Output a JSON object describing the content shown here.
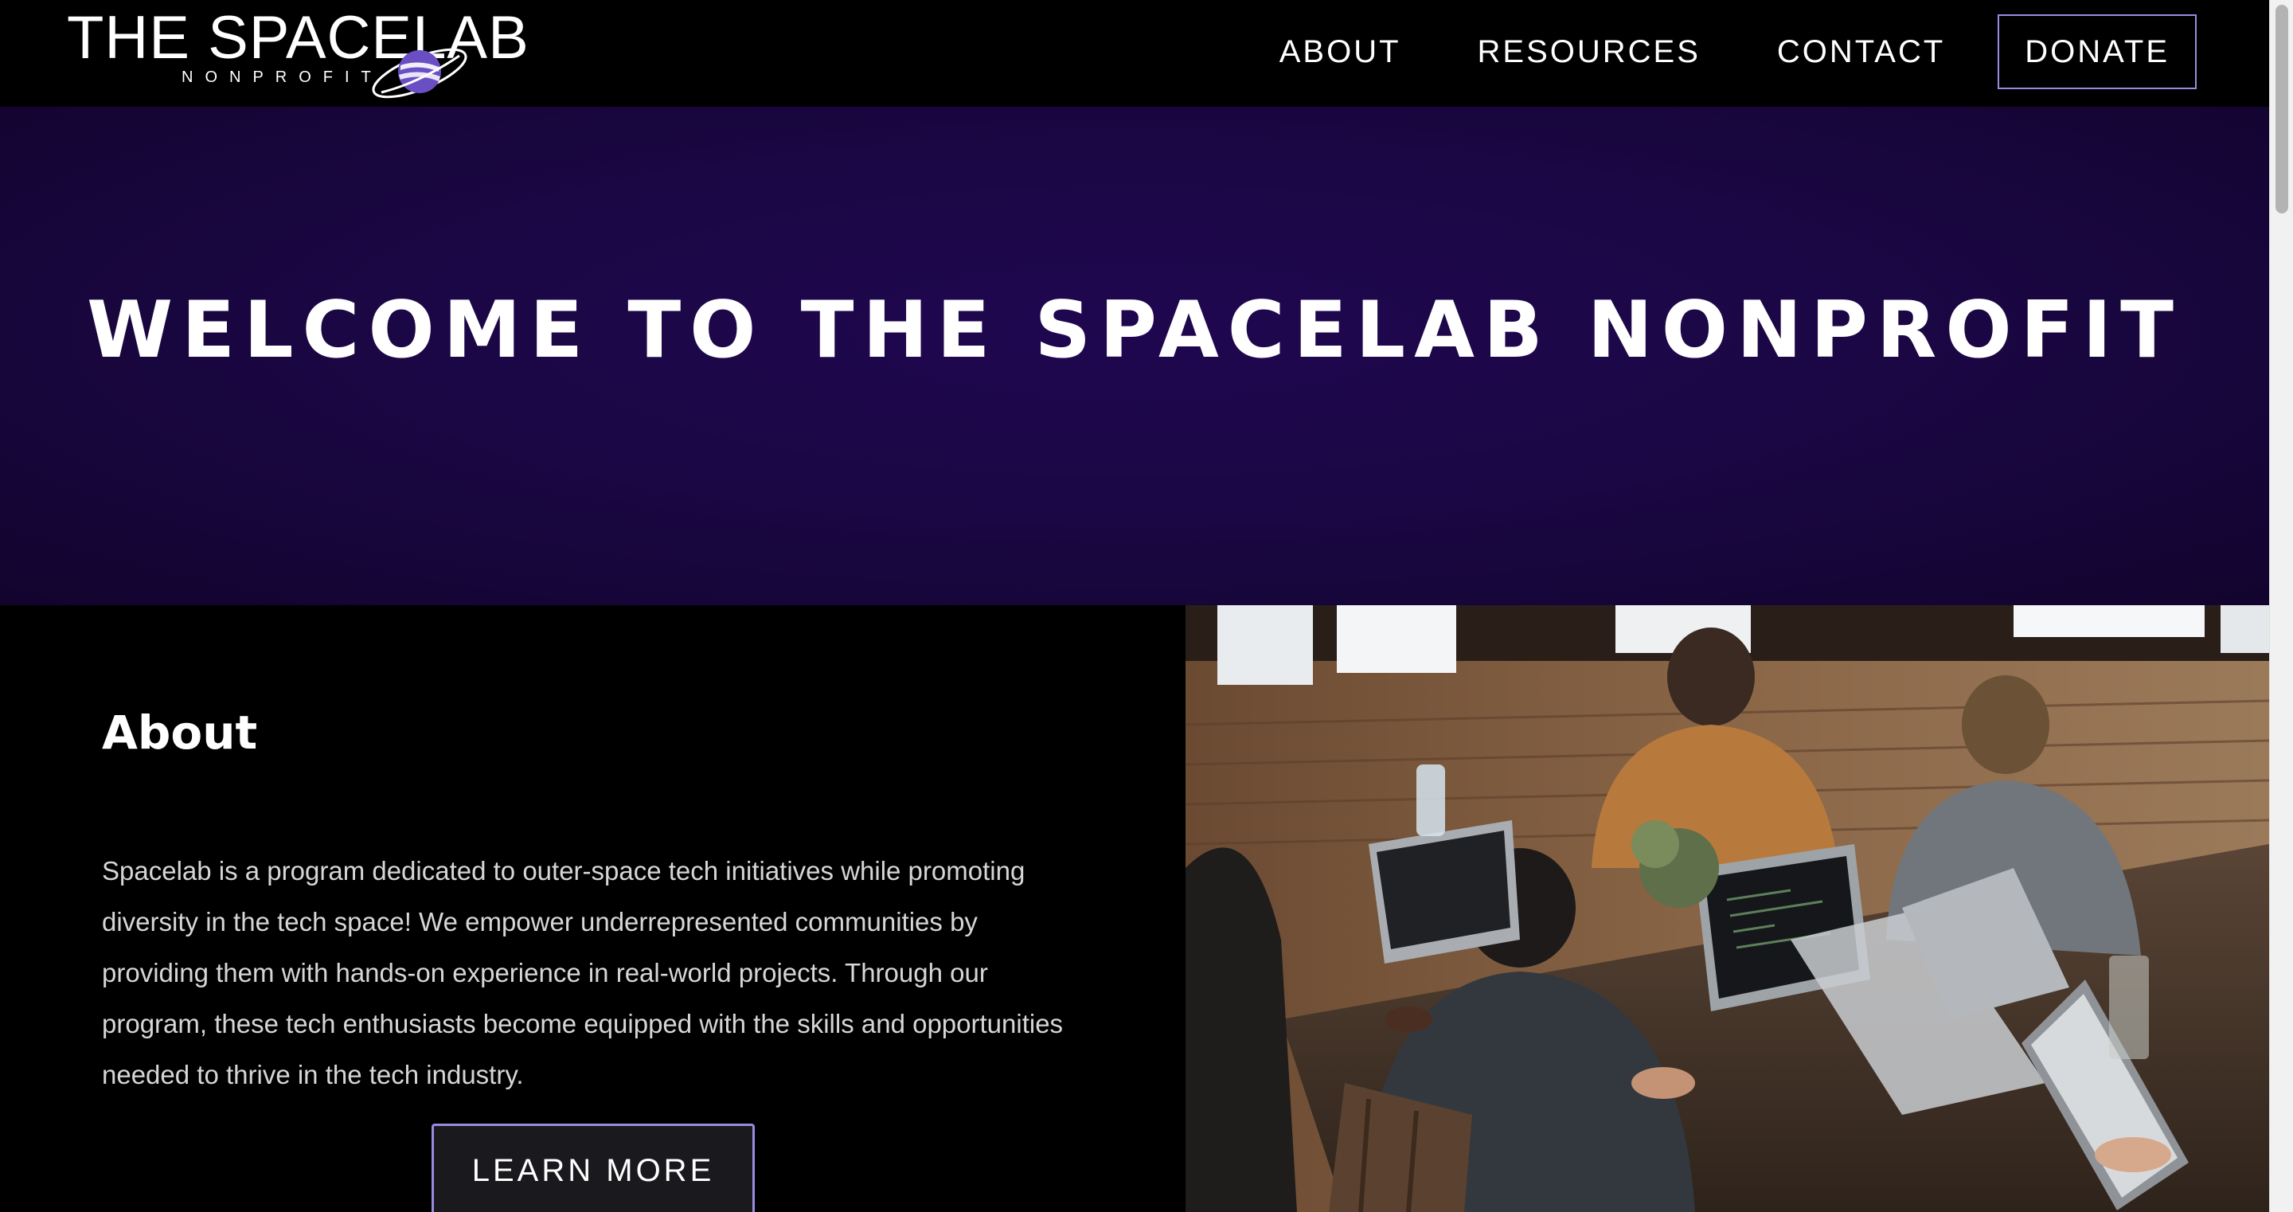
{
  "header": {
    "logo": {
      "title": "THE SPACELAB",
      "subtitle": "NONPROFIT",
      "planet_icon": "planet-icon"
    },
    "nav": [
      {
        "label": "ABOUT"
      },
      {
        "label": "RESOURCES"
      },
      {
        "label": "CONTACT"
      }
    ],
    "donate_label": "DONATE"
  },
  "hero": {
    "title": "WELCOME TO THE SPACELAB NONPROFIT"
  },
  "about": {
    "heading": "About",
    "body": "Spacelab is a program dedicated to outer-space tech initiatives while promoting diversity in the tech space! We empower underrepresented communities by providing them with hands-on experience in real-world projects. Through our program, these tech enthusiasts become equipped with the skills and opportunities needed to thrive in the tech industry.",
    "cta_label": "LEARN MORE"
  },
  "colors": {
    "accent_border": "#9b8ae0",
    "hero_background": "#1b0745",
    "page_background": "#000000"
  }
}
